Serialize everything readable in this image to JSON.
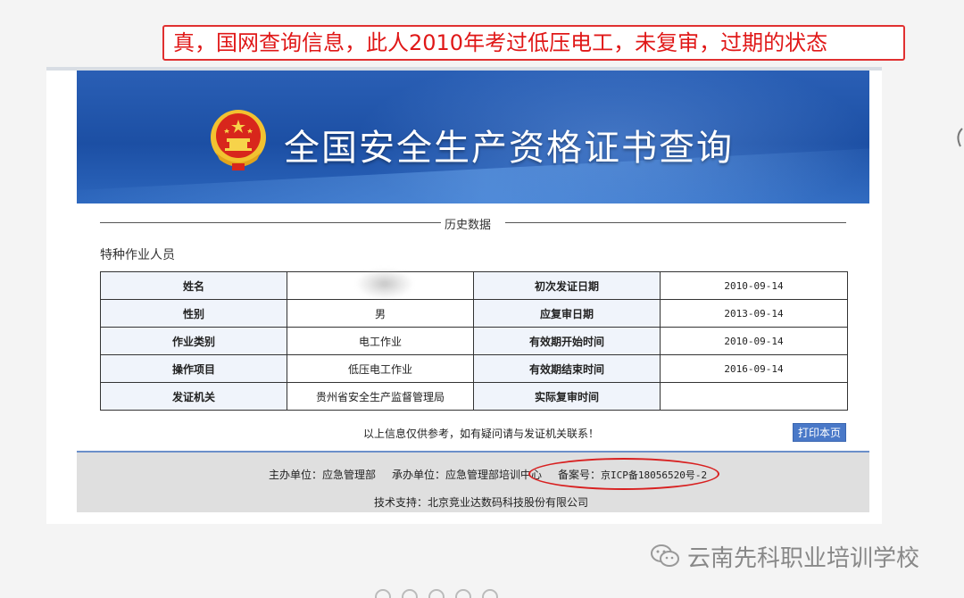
{
  "annotation": {
    "text": "真，国网查询信息，此人2010年考过低压电工，未复审，过期的状态"
  },
  "banner": {
    "title": "全国安全生产资格证书查询"
  },
  "section_title": "历史数据",
  "category": "特种作业人员",
  "table": {
    "rows": [
      {
        "label1": "姓名",
        "value1": "",
        "label2": "初次发证日期",
        "value2": "2010-09-14"
      },
      {
        "label1": "性别",
        "value1": "男",
        "label2": "应复审日期",
        "value2": "2013-09-14"
      },
      {
        "label1": "作业类别",
        "value1": "电工作业",
        "label2": "有效期开始时间",
        "value2": "2010-09-14"
      },
      {
        "label1": "操作项目",
        "value1": "低压电工作业",
        "label2": "有效期结束时间",
        "value2": "2016-09-14"
      },
      {
        "label1": "发证机关",
        "value1": "贵州省安全生产监督管理局",
        "label2": "实际复审时间",
        "value2": ""
      }
    ]
  },
  "note": "以上信息仅供参考，如有疑问请与发证机关联系！",
  "print_button": "打印本页",
  "footer": {
    "host": "主办单位：应急管理部",
    "organizer": "承办单位：应急管理部培训中心",
    "icp_label": "备案号：",
    "icp_value": "京ICP备18056520号-2",
    "tech_support": "技术支持：北京竞业达数码科技股份有限公司"
  },
  "watermark": {
    "text": "云南先科职业培训学校",
    "icon": "wechat-icon"
  },
  "colors": {
    "annotation_red": "#e01818",
    "banner_blue": "#1c4fa4",
    "print_button": "#4a79c8",
    "footer_bg": "#dfdfdf"
  }
}
